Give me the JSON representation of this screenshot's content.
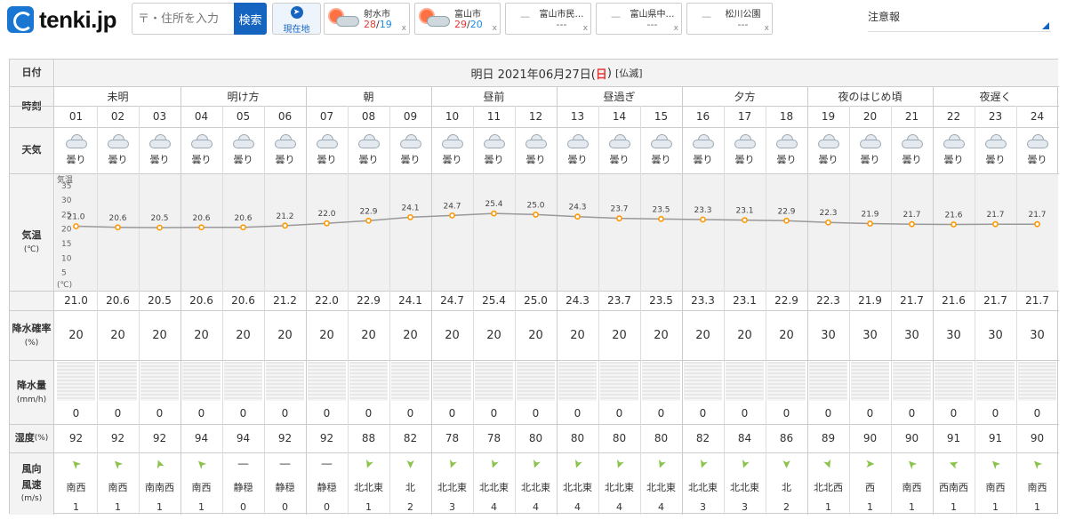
{
  "header": {
    "logo_text": "tenki.jp",
    "search_placeholder": "〒・住所を入力",
    "search_button": "検索",
    "geo_label": "現在地",
    "warnings_label": "注意報",
    "history": [
      {
        "name": "射水市",
        "high": "28",
        "low": "19",
        "has_weather": true
      },
      {
        "name": "富山市",
        "high": "29",
        "low": "20",
        "has_weather": true
      },
      {
        "name": "富山市民…",
        "value": "---",
        "has_weather": false
      },
      {
        "name": "富山県中…",
        "value": "---",
        "has_weather": false
      },
      {
        "name": "松川公園",
        "value": "---",
        "has_weather": false
      }
    ],
    "close_mark": "x"
  },
  "table": {
    "label_date": "日付",
    "date_prefix": "明日 2021年06月27日(",
    "date_day": "日",
    "date_suffix": ")",
    "rokuyo": "[仏滅]",
    "label_time": "時刻",
    "label_weather": "天気",
    "label_temp": "気温",
    "label_temp_unit": "(℃)",
    "label_precip_prob": "降水確率",
    "label_precip_prob_unit": "(%)",
    "label_precip": "降水量",
    "label_precip_unit": "(mm/h)",
    "label_humidity": "湿度",
    "label_humidity_unit": "(%)",
    "label_wind_dir": "風向",
    "label_wind_speed": "風速",
    "label_wind_speed_unit": "(m/s)",
    "periods": [
      "未明",
      "明け方",
      "朝",
      "昼前",
      "昼過ぎ",
      "夕方",
      "夜のはじめ頃",
      "夜遅く"
    ],
    "hours": [
      "01",
      "02",
      "03",
      "04",
      "05",
      "06",
      "07",
      "08",
      "09",
      "10",
      "11",
      "12",
      "13",
      "14",
      "15",
      "16",
      "17",
      "18",
      "19",
      "20",
      "21",
      "22",
      "23",
      "24"
    ],
    "weather": [
      "曇り",
      "曇り",
      "曇り",
      "曇り",
      "曇り",
      "曇り",
      "曇り",
      "曇り",
      "曇り",
      "曇り",
      "曇り",
      "曇り",
      "曇り",
      "曇り",
      "曇り",
      "曇り",
      "曇り",
      "曇り",
      "曇り",
      "曇り",
      "曇り",
      "曇り",
      "曇り",
      "曇り"
    ],
    "weather_icon": "cloud-icon",
    "temperature": [
      "21.0",
      "20.6",
      "20.5",
      "20.6",
      "20.6",
      "21.2",
      "22.0",
      "22.9",
      "24.1",
      "24.7",
      "25.4",
      "25.0",
      "24.3",
      "23.7",
      "23.5",
      "23.3",
      "23.1",
      "22.9",
      "22.3",
      "21.9",
      "21.7",
      "21.6",
      "21.7",
      "21.7"
    ],
    "precip_prob": [
      "20",
      "20",
      "20",
      "20",
      "20",
      "20",
      "20",
      "20",
      "20",
      "20",
      "20",
      "20",
      "20",
      "20",
      "20",
      "20",
      "20",
      "20",
      "30",
      "30",
      "30",
      "30",
      "30",
      "30"
    ],
    "precip": [
      "0",
      "0",
      "0",
      "0",
      "0",
      "0",
      "0",
      "0",
      "0",
      "0",
      "0",
      "0",
      "0",
      "0",
      "0",
      "0",
      "0",
      "0",
      "0",
      "0",
      "0",
      "0",
      "0",
      "0"
    ],
    "humidity": [
      "92",
      "92",
      "92",
      "94",
      "94",
      "92",
      "92",
      "88",
      "82",
      "78",
      "78",
      "80",
      "80",
      "80",
      "80",
      "82",
      "84",
      "86",
      "89",
      "90",
      "90",
      "91",
      "91",
      "90"
    ],
    "wind_dir": [
      "南西",
      "南西",
      "南南西",
      "南西",
      "静穏",
      "静穏",
      "静穏",
      "北北東",
      "北",
      "北北東",
      "北北東",
      "北北東",
      "北北東",
      "北北東",
      "北北東",
      "北北東",
      "北北東",
      "北",
      "北北西",
      "西",
      "南西",
      "西南西",
      "南西",
      "南西"
    ],
    "wind_speed": [
      "1",
      "1",
      "1",
      "1",
      "0",
      "0",
      "0",
      "1",
      "2",
      "3",
      "4",
      "4",
      "4",
      "4",
      "4",
      "3",
      "3",
      "2",
      "1",
      "1",
      "1",
      "1",
      "1",
      "1"
    ],
    "colors": {
      "wind_icon": "#8bc34a",
      "temp_line": "#999999",
      "temp_dot": "#ff9800",
      "sunday": "#e53935"
    }
  },
  "chart_data": {
    "type": "line",
    "ylabel": "気温",
    "ylabel_unit": "(℃)",
    "y_ticks": [
      "35",
      "30",
      "25",
      "20",
      "15",
      "10",
      "5"
    ],
    "ylim": [
      0,
      38
    ],
    "x": [
      "01",
      "02",
      "03",
      "04",
      "05",
      "06",
      "07",
      "08",
      "09",
      "10",
      "11",
      "12",
      "13",
      "14",
      "15",
      "16",
      "17",
      "18",
      "19",
      "20",
      "21",
      "22",
      "23",
      "24"
    ],
    "values": [
      21.0,
      20.6,
      20.5,
      20.6,
      20.6,
      21.2,
      22.0,
      22.9,
      24.1,
      24.7,
      25.4,
      25.0,
      24.3,
      23.7,
      23.5,
      23.3,
      23.1,
      22.9,
      22.3,
      21.9,
      21.7,
      21.6,
      21.7,
      21.7
    ]
  }
}
